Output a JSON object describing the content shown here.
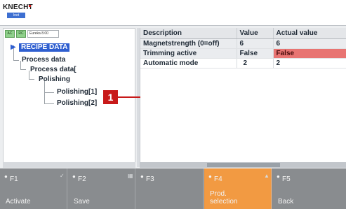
{
  "app": {
    "logo": "KNECHT",
    "logo_tag": "Inet"
  },
  "filter": {
    "chip_ac": "AC",
    "chip_rc": "RC",
    "input_value": "Eureka 8.00"
  },
  "tree": {
    "nodes": [
      {
        "label": "RECIPE DATA",
        "selected": true
      },
      {
        "label": "Process data"
      },
      {
        "label": "Process data["
      },
      {
        "label": "Polishing"
      },
      {
        "label": "Polishing[1]"
      },
      {
        "label": "Polishing[2]"
      }
    ]
  },
  "table": {
    "headers": {
      "description": "Description",
      "value": "Value",
      "actual": "Actual value"
    },
    "rows": [
      {
        "description": "Magnetstrength (0=off)",
        "value": "6",
        "actual": "6"
      },
      {
        "description": "Trimming active",
        "value": "False",
        "actual": "False",
        "actual_alert": true
      },
      {
        "description": "Automatic mode",
        "value": "2",
        "actual": "2"
      }
    ]
  },
  "callout": {
    "number": "1",
    "color": "#c81a1a"
  },
  "function_keys": [
    {
      "code": "F1",
      "label": "Activate",
      "active": false
    },
    {
      "code": "F2",
      "label": "Save",
      "active": false
    },
    {
      "code": "F3",
      "label": "",
      "active": false
    },
    {
      "code": "F4",
      "label": "Prod. selection",
      "active": true
    },
    {
      "code": "F5",
      "label": "Back",
      "active": false
    }
  ],
  "colors": {
    "accent": "#f29a42",
    "selection": "#2f5fd0",
    "alert": "#e87472"
  }
}
